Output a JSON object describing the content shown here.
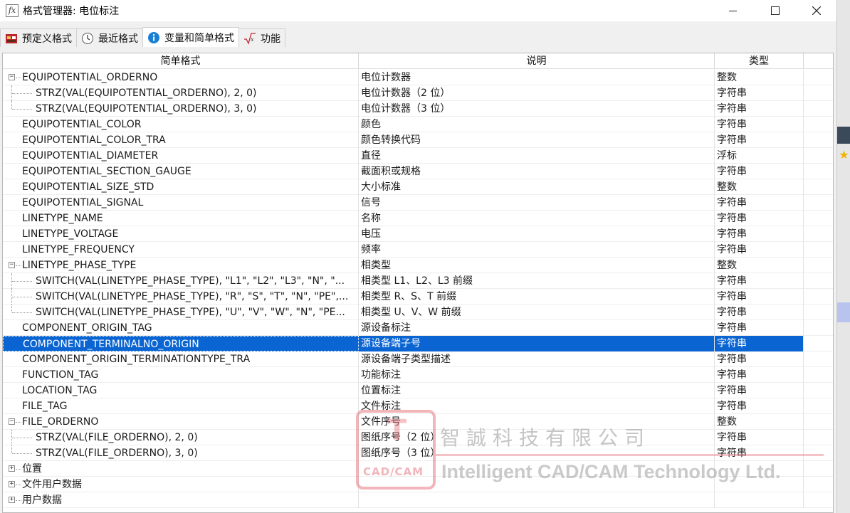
{
  "window": {
    "title": "格式管理器: 电位标注",
    "icon": "fx"
  },
  "tabs": [
    {
      "label": "预定义格式",
      "icon": "predefined-icon"
    },
    {
      "label": "最近格式",
      "icon": "clock-icon"
    },
    {
      "label": "变量和简单格式",
      "icon": "info-icon",
      "active": true
    },
    {
      "label": "功能",
      "icon": "function-icon"
    }
  ],
  "table": {
    "headers": [
      "简单格式",
      "说明",
      "类型"
    ],
    "rows": [
      {
        "name": "EQUIPOTENTIAL_ORDERNO",
        "desc": "电位计数器",
        "type": "整数",
        "level": 0,
        "expander": "−"
      },
      {
        "name": "STRZ(VAL(EQUIPOTENTIAL_ORDERNO), 2, 0)",
        "desc": "电位计数器（2 位）",
        "type": "字符串",
        "level": 1
      },
      {
        "name": "STRZ(VAL(EQUIPOTENTIAL_ORDERNO), 3, 0)",
        "desc": "电位计数器（3 位）",
        "type": "字符串",
        "level": 1
      },
      {
        "name": "EQUIPOTENTIAL_COLOR",
        "desc": "颜色",
        "type": "字符串",
        "level": 0
      },
      {
        "name": "EQUIPOTENTIAL_COLOR_TRA",
        "desc": "颜色转换代码",
        "type": "字符串",
        "level": 0
      },
      {
        "name": "EQUIPOTENTIAL_DIAMETER",
        "desc": "直径",
        "type": "浮标",
        "level": 0
      },
      {
        "name": "EQUIPOTENTIAL_SECTION_GAUGE",
        "desc": "截面积或规格",
        "type": "字符串",
        "level": 0
      },
      {
        "name": "EQUIPOTENTIAL_SIZE_STD",
        "desc": "大小标准",
        "type": "整数",
        "level": 0
      },
      {
        "name": "EQUIPOTENTIAL_SIGNAL",
        "desc": "信号",
        "type": "字符串",
        "level": 0
      },
      {
        "name": "LINETYPE_NAME",
        "desc": "名称",
        "type": "字符串",
        "level": 0
      },
      {
        "name": "LINETYPE_VOLTAGE",
        "desc": "电压",
        "type": "字符串",
        "level": 0
      },
      {
        "name": "LINETYPE_FREQUENCY",
        "desc": "频率",
        "type": "字符串",
        "level": 0
      },
      {
        "name": "LINETYPE_PHASE_TYPE",
        "desc": "相类型",
        "type": "整数",
        "level": 0,
        "expander": "−"
      },
      {
        "name": "SWITCH(VAL(LINETYPE_PHASE_TYPE), \"L1\", \"L2\", \"L3\", \"N\", \"...",
        "desc": "相类型 L1、L2、L3 前缀",
        "type": "字符串",
        "level": 1
      },
      {
        "name": "SWITCH(VAL(LINETYPE_PHASE_TYPE), \"R\", \"S\", \"T\", \"N\", \"PE\",...",
        "desc": "相类型 R、S、T 前缀",
        "type": "字符串",
        "level": 1
      },
      {
        "name": "SWITCH(VAL(LINETYPE_PHASE_TYPE), \"U\", \"V\", \"W\", \"N\", \"PE...",
        "desc": "相类型 U、V、W 前缀",
        "type": "字符串",
        "level": 1
      },
      {
        "name": "COMPONENT_ORIGIN_TAG",
        "desc": "源设备标注",
        "type": "字符串",
        "level": 0
      },
      {
        "name": "COMPONENT_TERMINALNO_ORIGIN",
        "desc": "源设备端子号",
        "type": "字符串",
        "level": 0,
        "selected": true
      },
      {
        "name": "COMPONENT_ORIGIN_TERMINATIONTYPE_TRA",
        "desc": "源设备端子类型描述",
        "type": "字符串",
        "level": 0
      },
      {
        "name": "FUNCTION_TAG",
        "desc": "功能标注",
        "type": "字符串",
        "level": 0
      },
      {
        "name": "LOCATION_TAG",
        "desc": "位置标注",
        "type": "字符串",
        "level": 0
      },
      {
        "name": "FILE_TAG",
        "desc": "文件标注",
        "type": "字符串",
        "level": 0
      },
      {
        "name": "FILE_ORDERNO",
        "desc": "文件序号",
        "type": "整数",
        "level": 0,
        "expander": "−"
      },
      {
        "name": "STRZ(VAL(FILE_ORDERNO), 2, 0)",
        "desc": "图纸序号（2 位）",
        "type": "字符串",
        "level": 1
      },
      {
        "name": "STRZ(VAL(FILE_ORDERNO), 3, 0)",
        "desc": "图纸序号（3 位）",
        "type": "字符串",
        "level": 1
      },
      {
        "name": "位置",
        "desc": "",
        "type": "",
        "level": 0,
        "expander": "+"
      },
      {
        "name": "文件用户数据",
        "desc": "",
        "type": "",
        "level": 0,
        "expander": "+"
      },
      {
        "name": "用户数据",
        "desc": "",
        "type": "",
        "level": 0,
        "expander": "+"
      }
    ]
  },
  "watermark": {
    "logo_letter": "T",
    "logo_sub": "CAD/CAM",
    "company_zh": "智誠科技有限公司",
    "company_en": "Intelligent CAD/CAM Technology Ltd."
  },
  "colors": {
    "selection": "#0a64d2",
    "accent_info": "#1a7fd4"
  }
}
